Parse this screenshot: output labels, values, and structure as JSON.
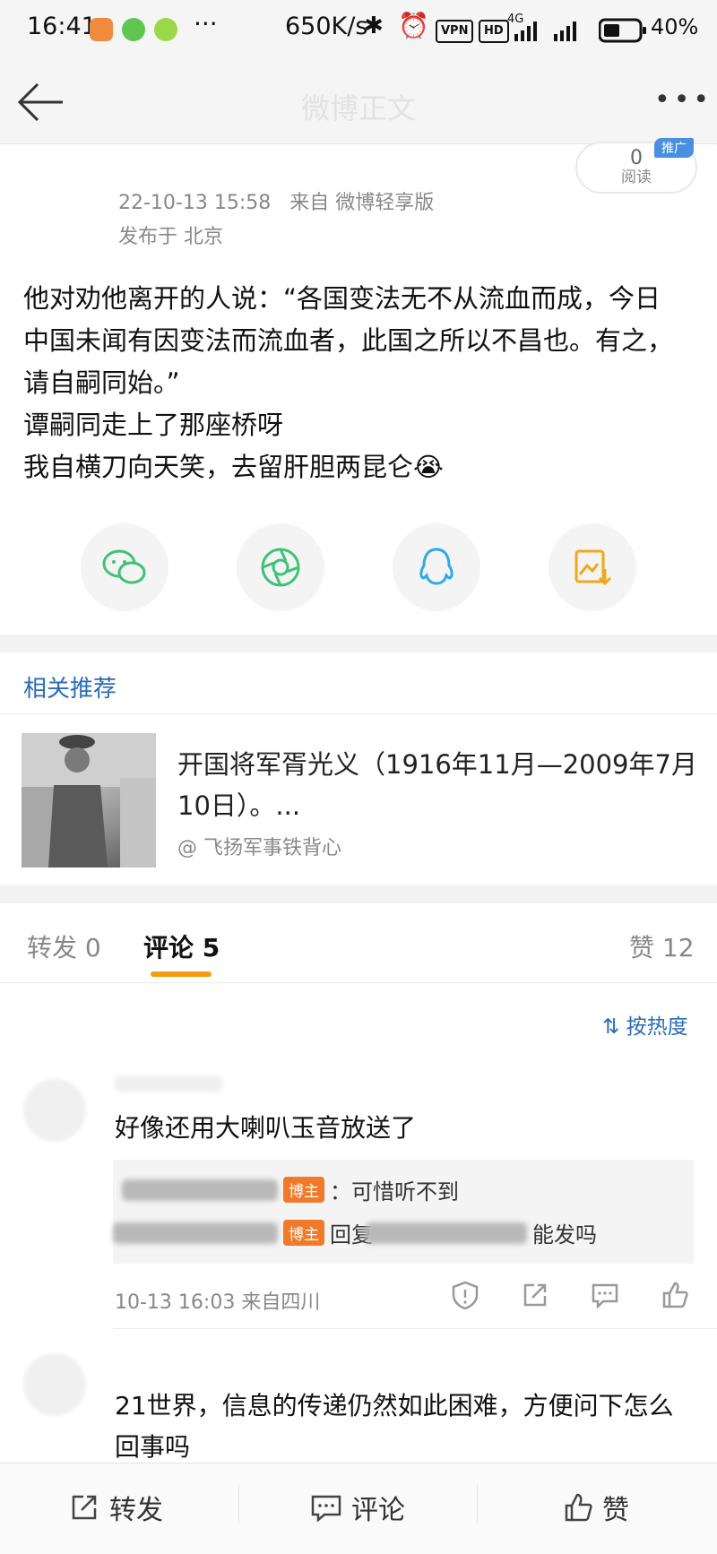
{
  "status_bar": {
    "time": "16:41",
    "speed": "650K/s",
    "vpn_label": "VPN",
    "hd_label": "HD",
    "network_label": "4G",
    "battery": "40%"
  },
  "nav": {
    "title": "微博正文"
  },
  "post": {
    "timestamp": "22-10-13 15:58",
    "source": "来自 微博轻享版",
    "location": "发布于 北京",
    "read_count": "0",
    "read_label": "阅读",
    "tag": "推广",
    "lines": [
      "他对劝他离开的人说：“各国变法无不从流血而成，今日",
      "中国未闻有因变法而流血者，此国之所以不昌也。有之，",
      "请自嗣同始。”",
      "谭嗣同走上了那座桥呀",
      "我自横刀向天笑，去留肝胆两昆仑😭"
    ]
  },
  "share_icons": [
    "wechat-icon",
    "moments-icon",
    "qq-icon",
    "save-image-icon"
  ],
  "related": {
    "section_title": "相关推荐",
    "item_title": "开国将军胥光义（1916年11月—2009年7月10日）。...",
    "item_source": "@ 飞扬军事铁背心"
  },
  "tabs": {
    "repost": "转发 0",
    "comment": "评论 5",
    "like": "赞 12",
    "sort_label": "按热度"
  },
  "comments": [
    {
      "text": "好像还用大喇叭玉音放送了",
      "replies": [
        {
          "badge": "博主",
          "text": "：可惜听不到"
        },
        {
          "badge": "博主",
          "prefix": "回复",
          "suffix": "能发吗"
        }
      ],
      "meta": "10-13 16:03  来自四川"
    },
    {
      "text": "21世界，信息的传递仍然如此困难，方便问下怎么回事吗"
    }
  ],
  "bottom_bar": {
    "repost": "转发",
    "comment": "评论",
    "like": "赞"
  },
  "colors": {
    "accent_blue": "#2a6db6",
    "tab_underline": "#f39c12",
    "badge_orange": "#f07a2a"
  }
}
